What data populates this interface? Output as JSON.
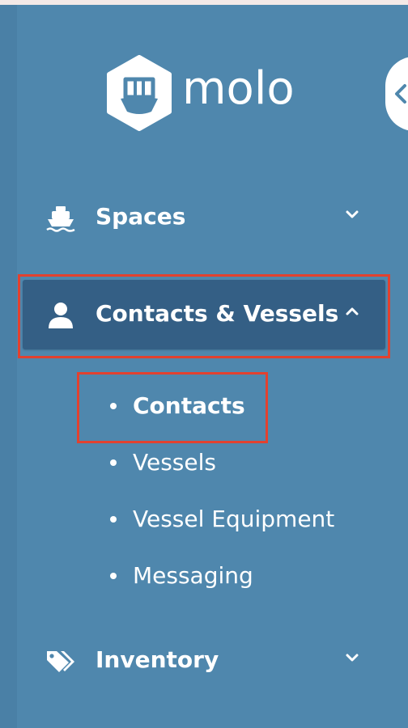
{
  "brand": {
    "name": "molo"
  },
  "sidebar": {
    "collapse_icon": "chevron-left-icon",
    "items": [
      {
        "label": "Spaces",
        "icon": "boat-icon",
        "chevron": "chevron-down-icon",
        "expanded": false
      },
      {
        "label": "Contacts & Vessels",
        "icon": "person-icon",
        "chevron": "chevron-up-icon",
        "expanded": true,
        "children": [
          {
            "label": "Contacts",
            "current": true
          },
          {
            "label": "Vessels",
            "current": false
          },
          {
            "label": "Vessel Equipment",
            "current": false
          },
          {
            "label": "Messaging",
            "current": false
          }
        ]
      },
      {
        "label": "Inventory",
        "icon": "tags-icon",
        "chevron": "chevron-down-icon",
        "expanded": false
      }
    ]
  },
  "colors": {
    "sidebar_bg": "#4f87ad",
    "active_item_bg": "#345f85",
    "text": "#ffffff",
    "highlight_border": "#e2412f"
  }
}
